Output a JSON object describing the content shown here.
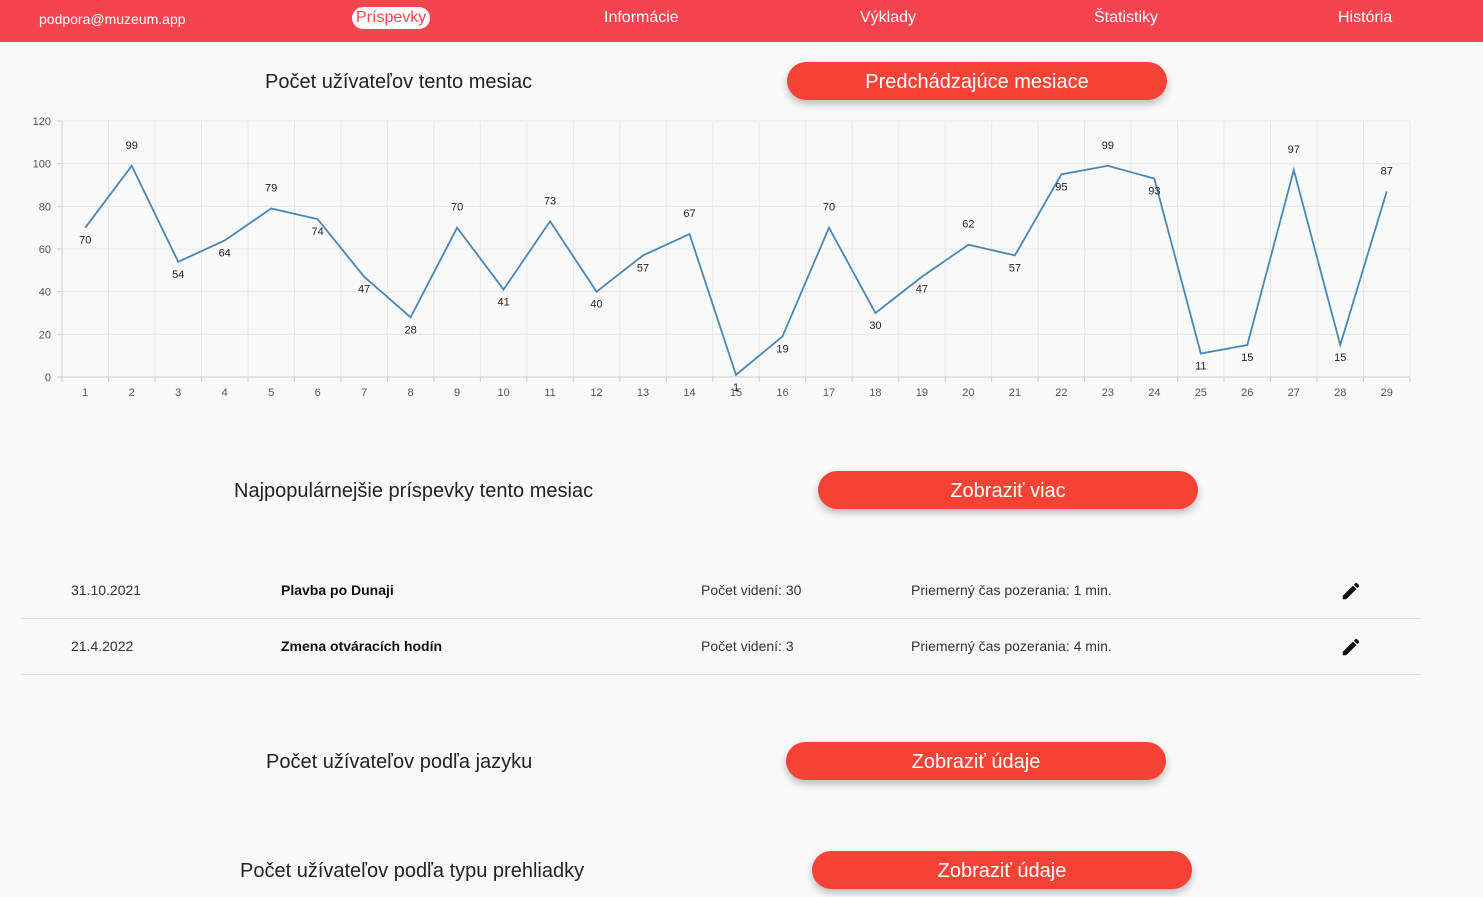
{
  "header": {
    "email": "podpora@muzeum.app",
    "nav": [
      "Príspevky",
      "Informácie",
      "Výklady",
      "Štatistiky",
      "História"
    ],
    "active_index": 0
  },
  "users_month": {
    "title": "Počet užívateľov tento mesiac",
    "button": "Predchádzajúce mesiace"
  },
  "chart_data": {
    "type": "line",
    "x": [
      1,
      2,
      3,
      4,
      5,
      6,
      7,
      8,
      9,
      10,
      11,
      12,
      13,
      14,
      15,
      16,
      17,
      18,
      19,
      20,
      21,
      22,
      23,
      24,
      25,
      26,
      27,
      28,
      29
    ],
    "values": [
      70,
      99,
      54,
      64,
      79,
      74,
      47,
      28,
      70,
      41,
      73,
      40,
      57,
      67,
      1,
      19,
      70,
      30,
      47,
      62,
      57,
      95,
      99,
      93,
      11,
      15,
      97,
      15,
      87
    ],
    "ylim": [
      0,
      120
    ],
    "yticks": [
      0,
      20,
      40,
      60,
      80,
      100,
      120
    ],
    "grid": true,
    "line_color": "#4a86b4"
  },
  "popular_posts": {
    "title": "Najpopulárnejšie príspevky tento mesiac",
    "button": "Zobraziť viac",
    "rows": [
      {
        "date": "31.10.2021",
        "title": "Plavba po Dunaji",
        "views": "Počet videní: 30",
        "avg": "Priemerný čas pozerania: 1 min.",
        "icon": "edit-icon"
      },
      {
        "date": "21.4.2022",
        "title": "Zmena otváracích hodín",
        "views": "Počet videní: 3",
        "avg": "Priemerný čas pozerania: 4 min.",
        "icon": "edit-icon"
      }
    ]
  },
  "users_language": {
    "title": "Počet užívateľov podľa jazyku",
    "button": "Zobraziť údaje"
  },
  "users_tour_type": {
    "title": "Počet užívateľov podľa typu prehliadky",
    "button": "Zobraziť údaje"
  }
}
